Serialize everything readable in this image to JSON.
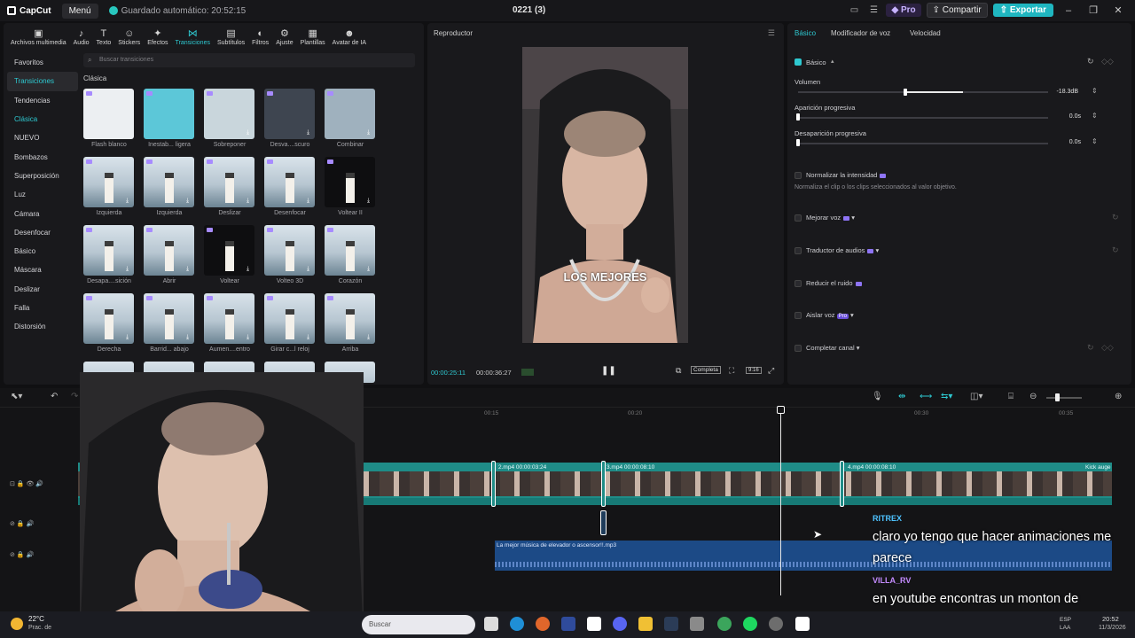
{
  "titlebar": {
    "app_name": "CapCut",
    "menu_label": "Menú",
    "autosave": "Guardado automático: 20:52:15",
    "project_title": "0221 (3)",
    "pro_label": "Pro",
    "share_label": "Compartir",
    "export_label": "Exportar"
  },
  "toolbar": {
    "items": [
      "Archivos multimedia",
      "Audio",
      "Texto",
      "Stickers",
      "Efectos",
      "Transiciones",
      "Subtítulos",
      "Filtros",
      "Ajuste",
      "Plantillas",
      "Avatar de IA"
    ],
    "active": "Transiciones"
  },
  "categories": [
    "Favoritos",
    "Transiciones",
    "Tendencias",
    "Clásica",
    "NUEVO",
    "Bombazos",
    "Superposición",
    "Luz",
    "Cámara",
    "Desenfocar",
    "Básico",
    "Máscara",
    "Deslizar",
    "Falla",
    "Distorsión"
  ],
  "search": {
    "placeholder": "Buscar transiciones"
  },
  "section_title": "Clásica",
  "transitions": [
    "Flash blanco",
    "Inestab... ligera",
    "Sobreponer",
    "Desva....scuro",
    "Combinar",
    "Izquierda",
    "Izquierda",
    "Deslizar",
    "Desenfocar",
    "Voltear II",
    "Desapa....sición",
    "Abrir",
    "Voltear",
    "Volteo 3D",
    "Corazón",
    "Derecha",
    "Barrid... abajo",
    "Aumen....entro",
    "Girar c...l reloj",
    "Arriba"
  ],
  "player": {
    "title": "Reproductor",
    "caption": "LOS MEJORES",
    "time_current": "00:00:25:11",
    "time_total": "00:00:36:27",
    "full_label": "Completa",
    "ratio_label": "9:16"
  },
  "right_panel": {
    "tabs": [
      "Básico",
      "Modificador de voz",
      "Velocidad"
    ],
    "section": "Básico",
    "volume_label": "Volumen",
    "volume_value": "-18.3dB",
    "volume_level": 0.43,
    "fade_in_label": "Aparición progresiva",
    "fade_in_value": "0.0s",
    "fade_out_label": "Desaparición progresiva",
    "fade_out_value": "0.0s",
    "normalize_label": "Normalizar la intensidad",
    "normalize_desc": "Normaliza el clip o los clips seleccionados al valor objetivo.",
    "enhance_label": "Mejorar voz",
    "translate_label": "Traductor de audios",
    "noise_label": "Reducir el ruido",
    "isolate_label": "Aislar voz",
    "isolate_badge": "Pro",
    "fill_label": "Completar canal"
  },
  "timeline": {
    "ruler": [
      "00:10",
      "00:15",
      "00:20",
      "00:30",
      "00:35"
    ],
    "clips": [
      {
        "name": "",
        "duration": "00:00:08:28"
      },
      {
        "name": "1.mp4",
        "duration": "00:00:06:13"
      },
      {
        "name": "2.mp4",
        "duration": "00:00:03:24"
      },
      {
        "name": "3.mp4",
        "duration": "00:00:08:10"
      },
      {
        "name": "4.mp4",
        "duration": "00:00:08:10"
      }
    ],
    "end_clip": "Kick auge",
    "audio_clip": "La mejor música de elevador o ascensor!!.mp3"
  },
  "chat": [
    {
      "user": "RITREX",
      "user_color": "#4ec3ff",
      "message": "claro yo tengo que hacer animaciones me parece"
    },
    {
      "user": "VILLA_RV",
      "user_color": "#c48cff",
      "message": "en youtube encontras un monton de tutoriales re faciles"
    }
  ],
  "taskbar": {
    "weather_temp": "22°C",
    "weather_desc": "Prac. de",
    "search_placeholder": "Buscar",
    "lang_line1": "ESP",
    "lang_line2": "LAA",
    "time": "20:52",
    "date": "11/3/2026"
  },
  "colors": {
    "accent": "#2ec8d0",
    "video_track": "#1f8c87",
    "audio_track": "#1c4a86"
  }
}
